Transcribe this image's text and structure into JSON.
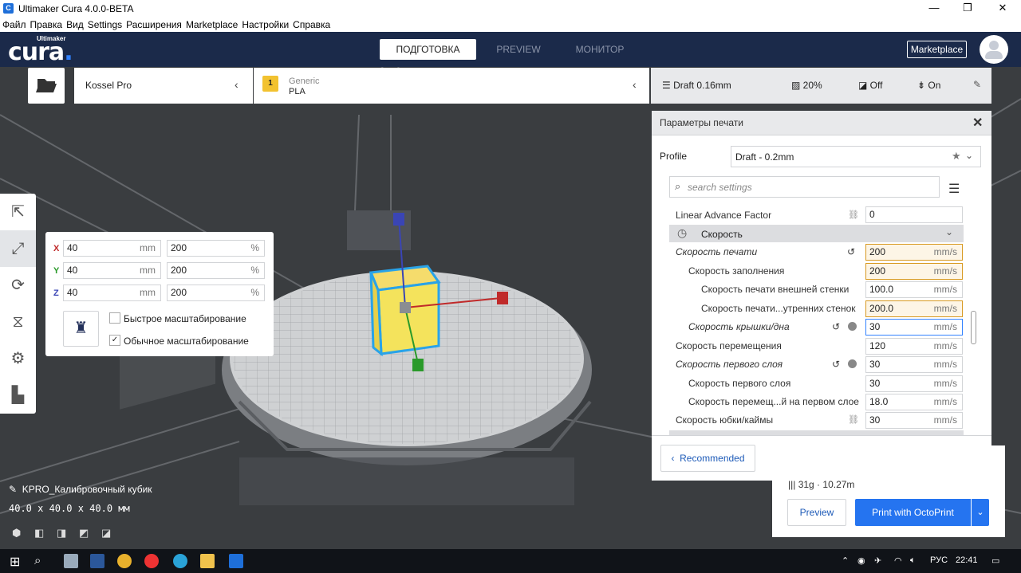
{
  "window": {
    "title": "Ultimaker Cura 4.0.0-BETA",
    "minimize": "—",
    "maximize": "❐",
    "close": "✕"
  },
  "menu": [
    "Файл",
    "Правка",
    "Вид",
    "Settings",
    "Расширения",
    "Marketplace",
    "Настройки",
    "Справка"
  ],
  "header": {
    "logo_small": "Ultimaker",
    "logo": "cura",
    "stages": {
      "prepare": "ПОДГОТОВКА",
      "preview": "PREVIEW",
      "monitor": "МОНИТОР"
    },
    "marketplace": "Marketplace"
  },
  "printer": {
    "name": "Kossel Pro"
  },
  "material": {
    "badge": "1",
    "brand": "Generic",
    "name": "PLA"
  },
  "quick_settings": {
    "profile": "Draft 0.16mm",
    "infill": "20%",
    "support": "Off",
    "adhesion": "On"
  },
  "scale_panel": {
    "x": {
      "label": "X",
      "mm": "40",
      "pct": "200"
    },
    "y": {
      "label": "Y",
      "mm": "40",
      "pct": "200"
    },
    "z": {
      "label": "Z",
      "mm": "40",
      "pct": "200"
    },
    "unit_mm": "mm",
    "unit_pct": "%",
    "snap_label": "Быстрое масштабирование",
    "uniform_label": "Обычное масштабирование",
    "uniform_checked": true,
    "check_mark": "✓"
  },
  "object": {
    "name": "KPRO_Калибровочный кубик",
    "dims": "40.0 x 40.0 x 40.0 мм"
  },
  "print_settings": {
    "title": "Параметры печати",
    "close": "✕",
    "profile_label": "Profile",
    "profile_value": "Draft - 0.2mm",
    "search_placeholder": "search settings",
    "linear_advance": {
      "label": "Linear Advance Factor",
      "value": "0"
    },
    "category": "Скорость",
    "unit": "mm/s",
    "rows": [
      {
        "label": "Скорость печати",
        "value": "200"
      },
      {
        "label": "Скорость заполнения",
        "value": "200"
      },
      {
        "label": "Скорость печати внешней стенки",
        "value": "100.0"
      },
      {
        "label": "Скорость печати...утренних стенок",
        "value": "200.0"
      },
      {
        "label": "Скорость крышки/дна",
        "value": "30"
      },
      {
        "label": "Скорость перемещения",
        "value": "120"
      },
      {
        "label": "Скорость первого слоя",
        "value": "30"
      },
      {
        "label": "Скорость первого слоя",
        "value": "30"
      },
      {
        "label": "Скорость перемещ...й на первом слое",
        "value": "18.0"
      },
      {
        "label": "Скорость юбки/каймы",
        "value": "30"
      }
    ],
    "recommended": "Recommended"
  },
  "output": {
    "info": "31g · 10.27m",
    "preview": "Preview",
    "print": "Print with OctoPrint"
  },
  "taskbar": {
    "lang": "РУС",
    "time": "22:41"
  },
  "colors": {
    "header": "#1b2a4a",
    "accent": "#2574f0",
    "warn": "#d89a22"
  }
}
